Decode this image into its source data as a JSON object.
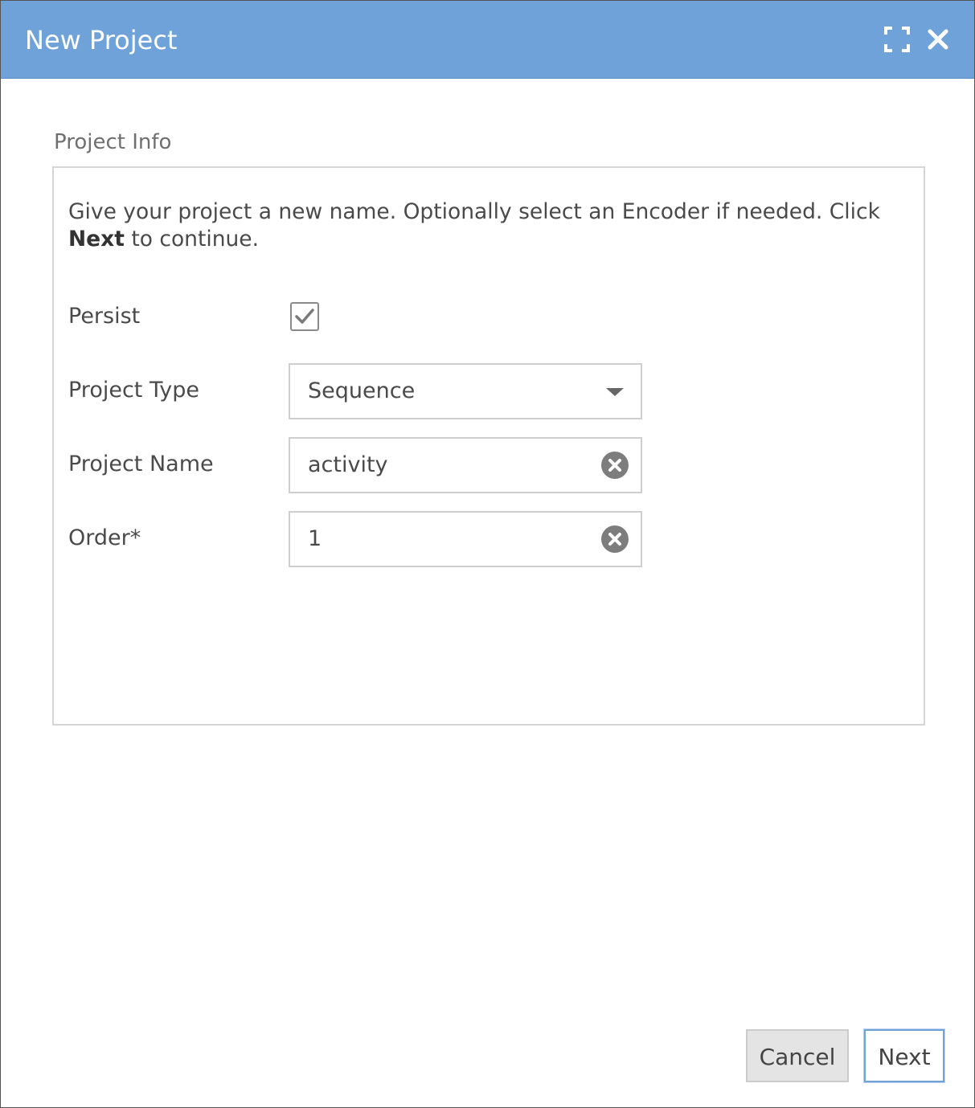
{
  "dialog": {
    "title": "New Project"
  },
  "project_info": {
    "section_label": "Project Info",
    "instructions": {
      "prefix": "Give your project a new name. Optionally select an Encoder if needed. Click ",
      "emphasis": "Next",
      "suffix": " to continue."
    },
    "fields": {
      "persist": {
        "label": "Persist",
        "checked": true
      },
      "project_type": {
        "label": "Project Type",
        "value": "Sequence"
      },
      "project_name": {
        "label": "Project Name",
        "value": "activity"
      },
      "order": {
        "label": "Order*",
        "value": "1"
      }
    }
  },
  "footer": {
    "cancel_label": "Cancel",
    "next_label": "Next"
  },
  "icons": {
    "maximize": "maximize-icon",
    "close": "close-icon",
    "checkbox": "checkmark-icon",
    "dropdown": "caret-down-icon",
    "clear": "clear-circle-icon"
  },
  "colors": {
    "titlebar": "#6fa2d8",
    "title_text": "#ffffff",
    "accent_border": "#6fa2d8"
  }
}
